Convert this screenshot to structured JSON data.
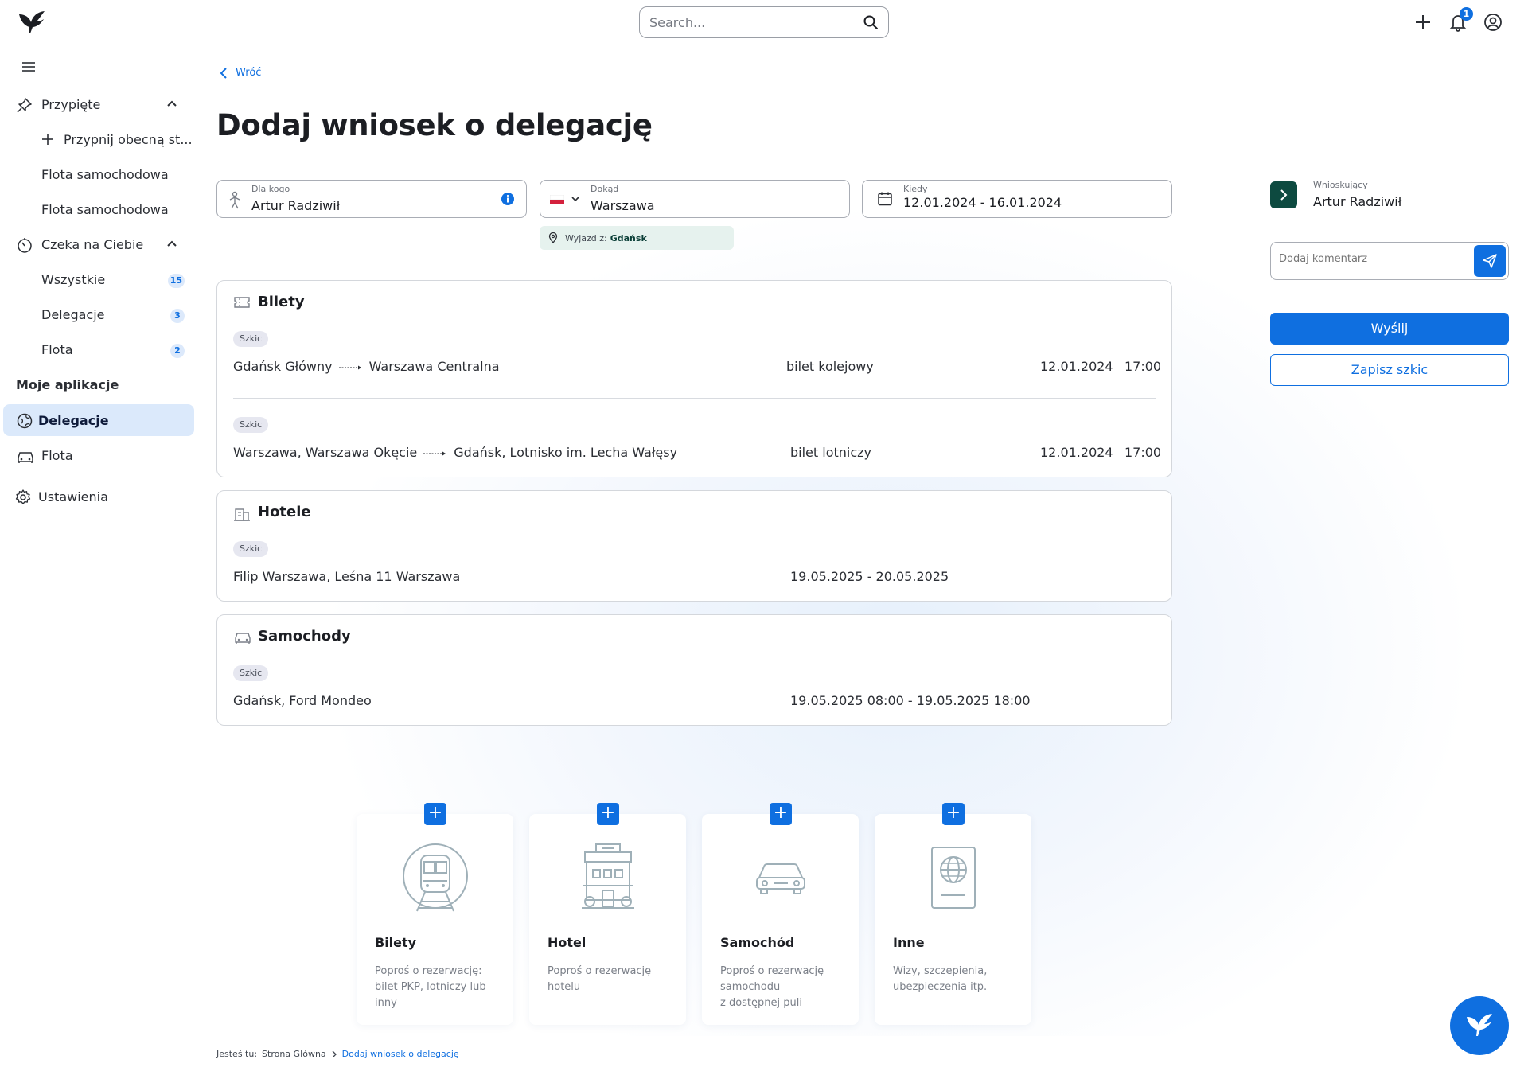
{
  "topbar": {
    "search_placeholder": "Search...",
    "notifications_count": "1"
  },
  "sidebar": {
    "pinned_label": "Przypięte",
    "pin_current": "Przypnij obecną st...",
    "pinned_items": [
      "Flota samochodowa",
      "Flota samochodowa"
    ],
    "waiting_label": "Czeka na Ciebie",
    "waiting_items": [
      {
        "label": "Wszystkie",
        "count": "15"
      },
      {
        "label": "Delegacje",
        "count": "3"
      },
      {
        "label": "Flota",
        "count": "2"
      }
    ],
    "apps_heading": "Moje aplikacje",
    "apps": [
      "Delegacje",
      "Flota"
    ],
    "settings_label": "Ustawienia"
  },
  "page": {
    "back_label": "Wróć",
    "title": "Dodaj wniosek o delegację"
  },
  "form": {
    "for_whom_label": "Dla kogo",
    "for_whom_value": "Artur Radziwił",
    "destination_label": "Dokąd",
    "destination_value": "Warszawa",
    "when_label": "Kiedy",
    "when_value": "12.01.2024 - 16.01.2024",
    "departure_label": "Wyjazd z:",
    "departure_value": "Gdańsk"
  },
  "tickets": {
    "title": "Bilety",
    "items": [
      {
        "status": "Szkic",
        "from": "Gdańsk Główny",
        "to": "Warszawa Centralna",
        "type": "bilet kolejowy",
        "date": "12.01.2024",
        "time": "17:00"
      },
      {
        "status": "Szkic",
        "from": "Warszawa, Warszawa Okęcie",
        "to": "Gdańsk, Lotnisko im. Lecha Wałęsy",
        "type": "bilet lotniczy",
        "date": "12.01.2024",
        "time": "17:00"
      }
    ]
  },
  "hotels": {
    "title": "Hotele",
    "items": [
      {
        "status": "Szkic",
        "name": "Filip Warszawa, Leśna 11 Warszawa",
        "dates": "19.05.2025 - 20.05.2025"
      }
    ]
  },
  "cars": {
    "title": "Samochody",
    "items": [
      {
        "status": "Szkic",
        "name": "Gdańsk, Ford Mondeo",
        "dates": "19.05.2025 08:00 - 19.05.2025 18:00"
      }
    ]
  },
  "tiles": [
    {
      "title": "Bilety",
      "desc": "Poproś o rezerwację:\nbilet PKP, lotniczy lub\ninny"
    },
    {
      "title": "Hotel",
      "desc": "Poproś o rezerwację\nhotelu"
    },
    {
      "title": "Samochód",
      "desc": "Poproś o rezerwację\nsamochodu\nz dostępnej puli"
    },
    {
      "title": "Inne",
      "desc": "Wizy, szczepienia,\nubezpieczenia itp."
    }
  ],
  "right_panel": {
    "requester_label": "Wnioskujący",
    "requester_value": "Artur Radziwił",
    "comment_placeholder": "Dodaj komentarz",
    "send_label": "Wyślij",
    "save_draft_label": "Zapisz szkic"
  },
  "breadcrumb": {
    "prefix": "Jesteś tu:",
    "home": "Strona Główna",
    "current": "Dodaj wniosek o delegację"
  },
  "colors": {
    "accent": "#0f6fe0",
    "dark_green": "#0d4a40",
    "active_nav_bg": "#dbe9fb"
  }
}
